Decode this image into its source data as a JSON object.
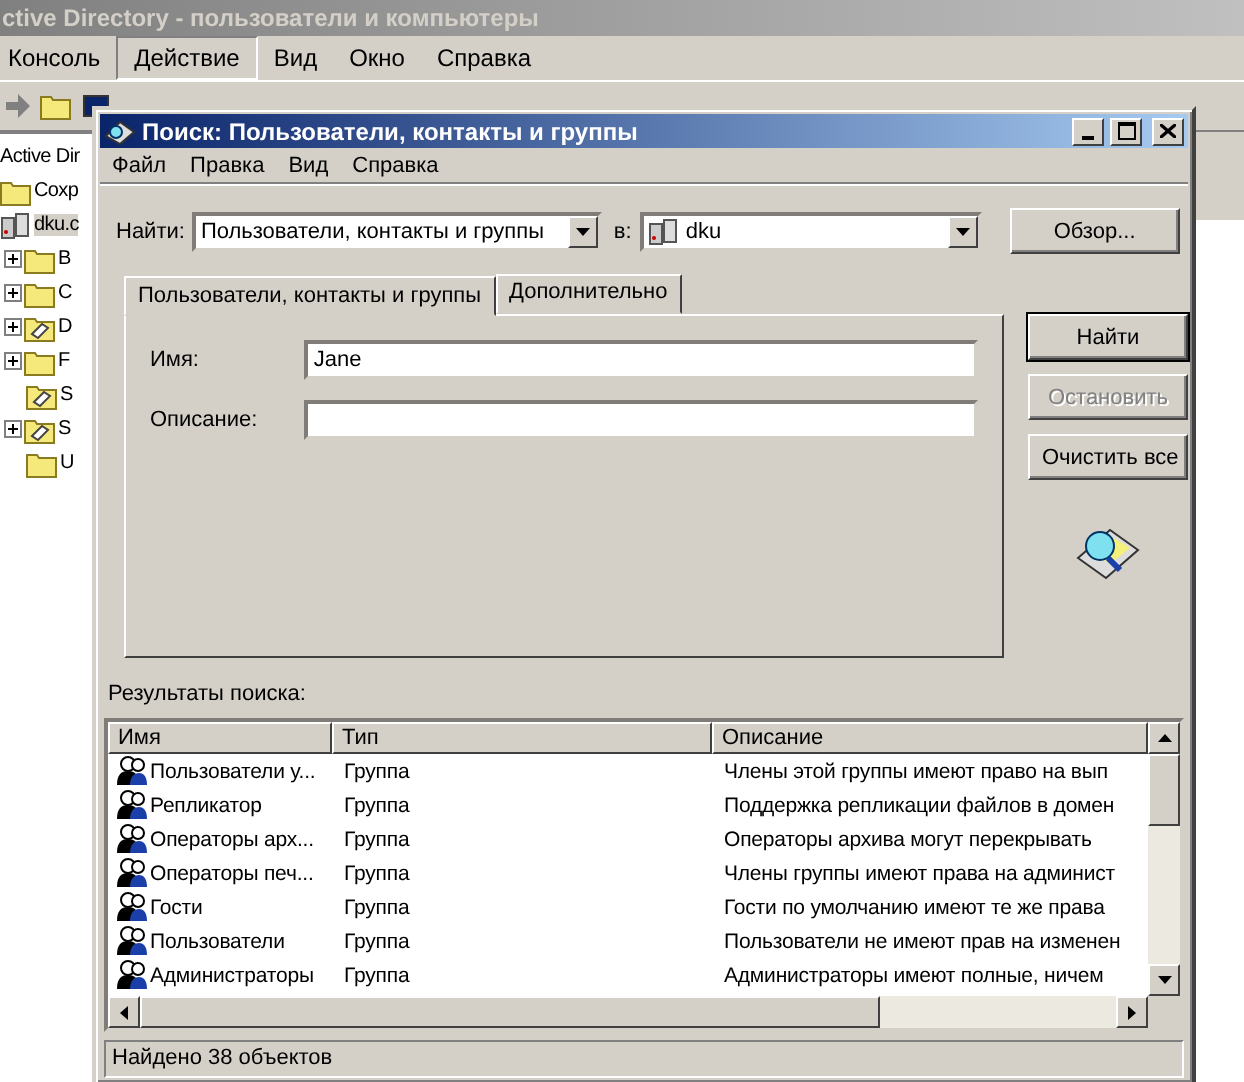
{
  "main_window": {
    "title": "ctive Directory - пользователи и компьютеры",
    "menu": [
      {
        "label": "Консоль",
        "selected": false
      },
      {
        "label": "Действие",
        "selected": true
      },
      {
        "label": "Вид",
        "selected": false
      },
      {
        "label": "Окно",
        "selected": false
      },
      {
        "label": "Справка",
        "selected": false
      }
    ],
    "tree": [
      {
        "label": "Active Dir",
        "expandable": false,
        "selected": false,
        "children": [
          {
            "label": "Coxp",
            "kind": "folder",
            "expandable": false,
            "selected": false
          },
          {
            "label": "dku.c",
            "kind": "domain",
            "expandable": false,
            "selected": true,
            "children": [
              {
                "label": "B",
                "kind": "folder",
                "expandable": true,
                "selected": false
              },
              {
                "label": "C",
                "kind": "folder",
                "expandable": true,
                "selected": false
              },
              {
                "label": "D",
                "kind": "ou",
                "expandable": true,
                "selected": false
              },
              {
                "label": "F",
                "kind": "folder",
                "expandable": true,
                "selected": false
              },
              {
                "label": "S",
                "kind": "ou",
                "expandable": false,
                "selected": false
              },
              {
                "label": "S",
                "kind": "ou",
                "expandable": true,
                "selected": false
              },
              {
                "label": "U",
                "kind": "folder",
                "expandable": false,
                "selected": false
              }
            ]
          }
        ]
      }
    ]
  },
  "dialog": {
    "title": "Поиск: Пользователи, контакты и группы",
    "menu": [
      "Файл",
      "Правка",
      "Вид",
      "Справка"
    ],
    "find_label": "Найти:",
    "find_value": "Пользователи, контакты и группы",
    "in_label": "в:",
    "in_value": "dku",
    "browse_button": "Обзор...",
    "tabs": [
      {
        "label": "Пользователи, контакты и группы",
        "selected": true
      },
      {
        "label": "Дополнительно",
        "selected": false
      }
    ],
    "fields": [
      {
        "label": "Имя:",
        "value": "Jane"
      },
      {
        "label": "Описание:"
      }
    ],
    "buttons": [
      {
        "label": "Найти",
        "default": true,
        "disabled": false
      },
      {
        "label": "Остановить",
        "default": false,
        "disabled": true
      },
      {
        "label": "Очистить все",
        "default": false,
        "disabled": false
      }
    ],
    "results_label": "Результаты поиска:",
    "columns": [
      "Имя",
      "Тип",
      "Описание"
    ],
    "rows": [
      {
        "name": "Пользователи у...",
        "type": "Группа",
        "description": "Члены этой группы имеют право на вып"
      },
      {
        "name": "Репликатор",
        "type": "Группа",
        "description": "Поддержка репликации файлов в домен"
      },
      {
        "name": "Операторы арх...",
        "type": "Группа",
        "description": "Операторы архива могут перекрывать"
      },
      {
        "name": "Операторы печ...",
        "type": "Группа",
        "description": "Члены группы имеют права на админист"
      },
      {
        "name": "Гости",
        "type": "Группа",
        "description": "Гости по умолчанию имеют те же права"
      },
      {
        "name": "Пользователи",
        "type": "Группа",
        "description": "Пользователи не имеют прав на изменен"
      },
      {
        "name": "Администраторы",
        "type": "Группа",
        "description": "Администраторы имеют полные, ничем"
      }
    ],
    "status": "Найдено 38 объектов"
  }
}
